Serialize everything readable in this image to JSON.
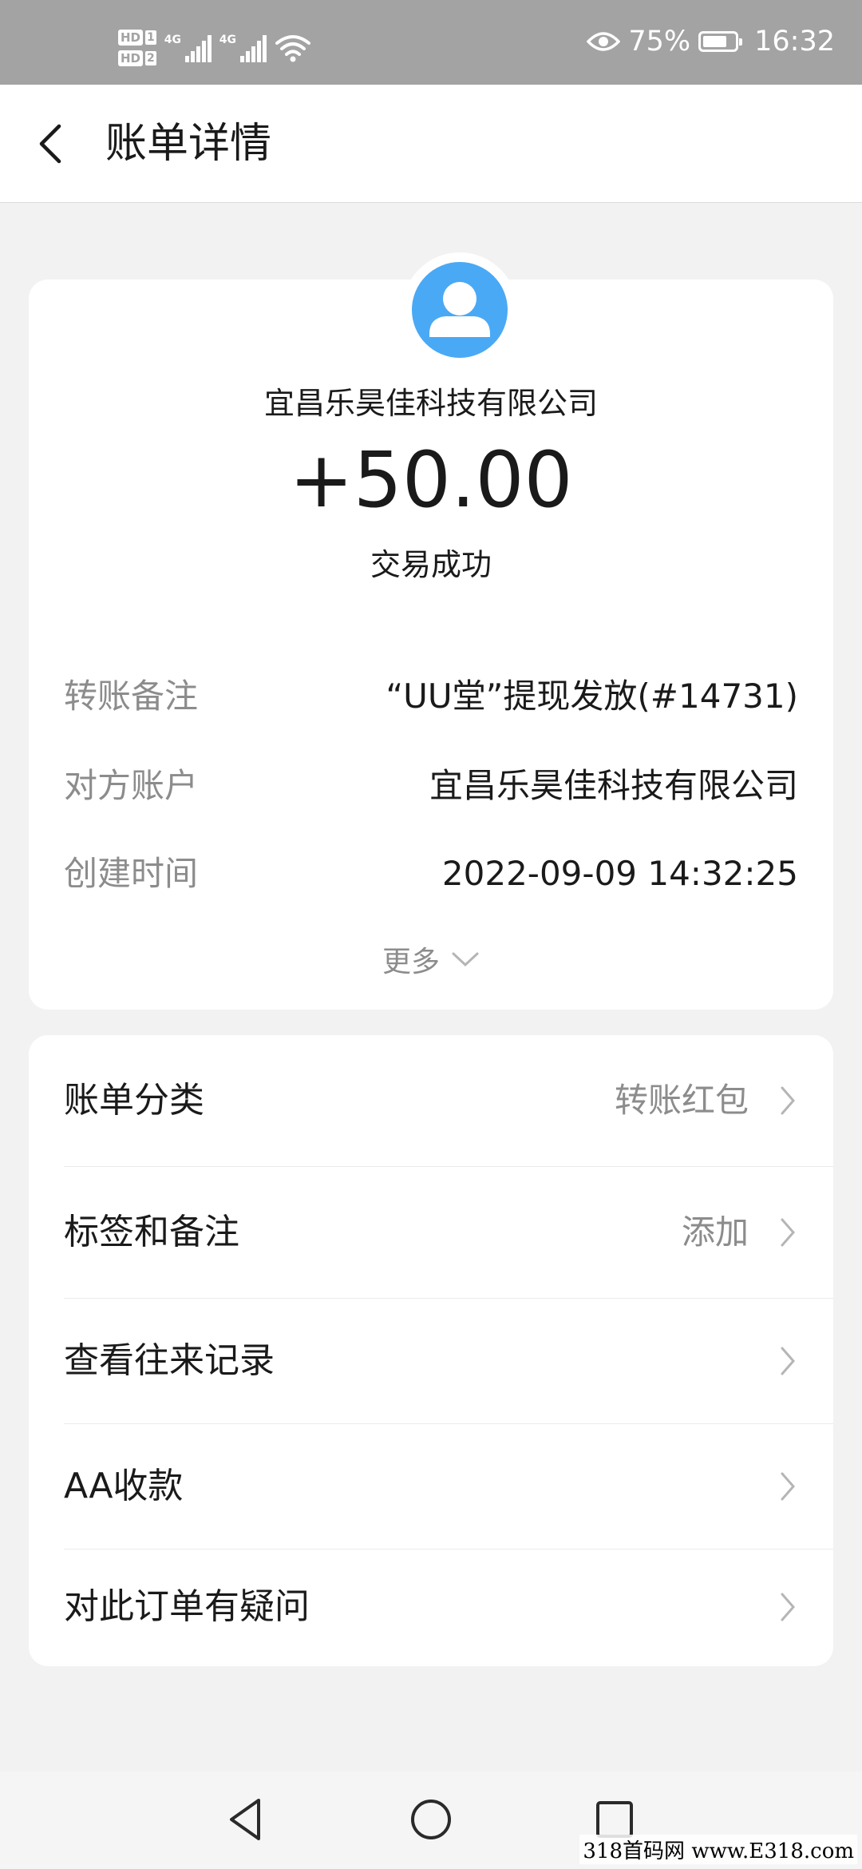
{
  "statusbar": {
    "hd1": "HD",
    "hd1_num": "1",
    "hd2": "HD",
    "hd2_num": "2",
    "net1": "4G",
    "net2": "4G",
    "battery_percent": "75%",
    "battery_level": 0.75,
    "time": "16:32"
  },
  "header": {
    "title": "账单详情"
  },
  "transaction": {
    "payee": "宜昌乐昊佳科技有限公司",
    "amount": "+50.00",
    "status": "交易成功",
    "details": [
      {
        "label": "转账备注",
        "value": "“UU堂”提现发放(#14731)"
      },
      {
        "label": "对方账户",
        "value": "宜昌乐昊佳科技有限公司"
      },
      {
        "label": "创建时间",
        "value": "2022-09-09 14:32:25"
      }
    ],
    "more_label": "更多"
  },
  "options": [
    {
      "label": "账单分类",
      "value": "转账红包"
    },
    {
      "label": "标签和备注",
      "value": "添加"
    },
    {
      "label": "查看往来记录",
      "value": ""
    },
    {
      "label": "AA收款",
      "value": ""
    },
    {
      "label": "对此订单有疑问",
      "value": ""
    }
  ],
  "watermark": "318首码网 www.E318.com",
  "colors": {
    "avatar": "#4aa9f5",
    "statusbar": "#a3a3a3",
    "secondary_text": "#8c8c8c"
  }
}
